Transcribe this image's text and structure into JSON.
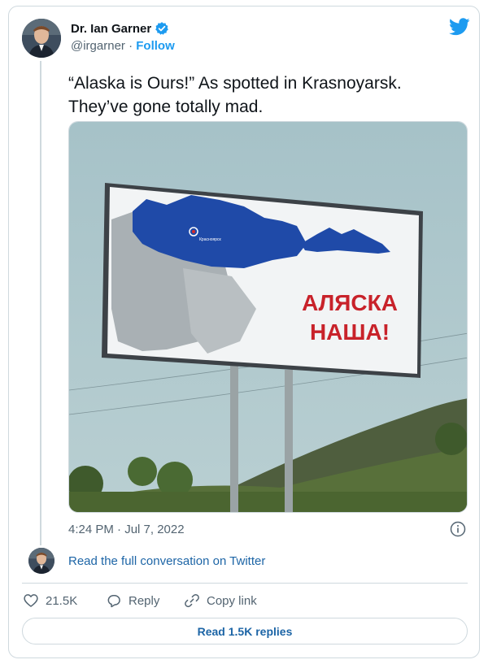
{
  "author": {
    "name": "Dr. Ian Garner",
    "handle": "@irgarner",
    "separator": "·",
    "follow_label": "Follow"
  },
  "tweet": {
    "line1": "“Alaska is Ours!” As spotted in Krasnoyarsk.",
    "line2": "They’ve gone totally mad.",
    "timestamp": "4:24 PM · Jul 7, 2022"
  },
  "billboard": {
    "city_label": "Красноярск",
    "slogan_line1": "АЛЯСКА",
    "slogan_line2": "НАША!"
  },
  "conversation": {
    "read_full_label": "Read the full conversation on Twitter"
  },
  "actions": {
    "likes": "21.5K",
    "reply_label": "Reply",
    "copy_link_label": "Copy link",
    "read_replies_label": "Read 1.5K replies"
  },
  "colors": {
    "brand": "#1d9bf0",
    "link": "#1d65a6",
    "muted": "#536471",
    "slogan": "#c8222a",
    "russia_fill": "#1f4aa8"
  },
  "icons": [
    "verified-badge-icon",
    "twitter-bird-icon",
    "info-icon",
    "heart-icon",
    "reply-icon",
    "link-icon"
  ]
}
